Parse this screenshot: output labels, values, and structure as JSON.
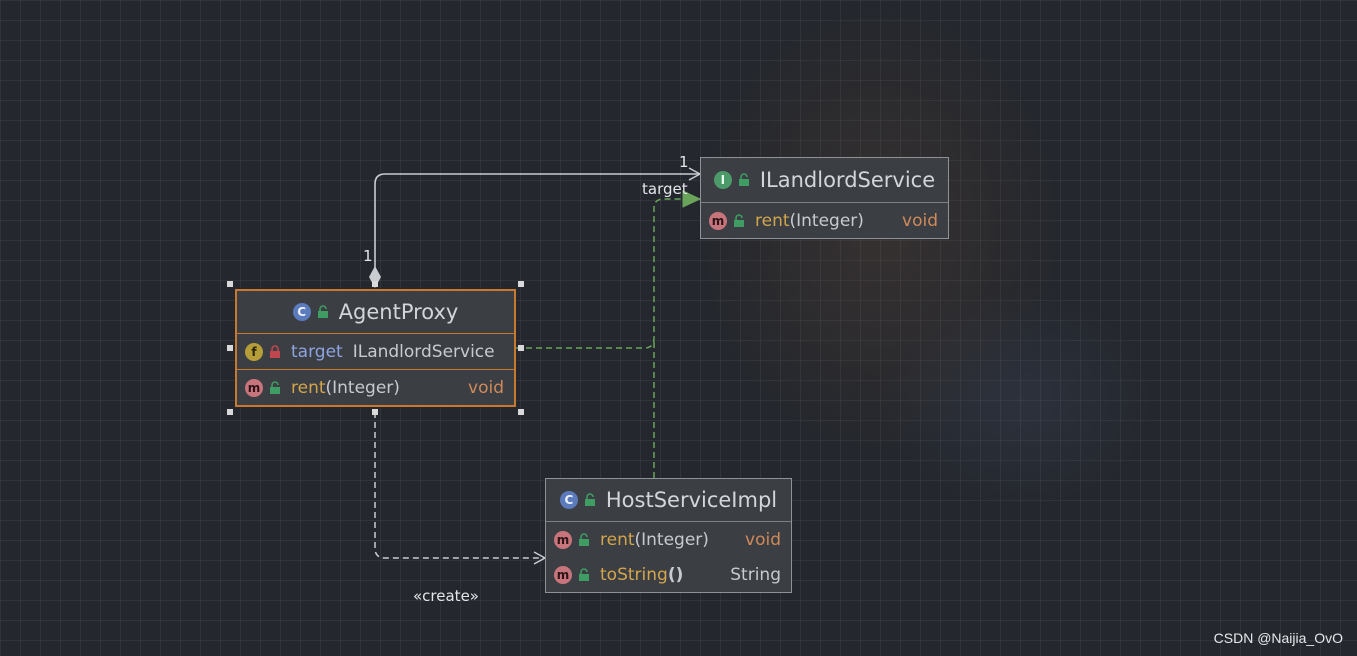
{
  "diagram": {
    "interface": {
      "name": "ILandlordService",
      "badge": "I",
      "methods": [
        {
          "badge": "m",
          "name": "rent",
          "params": "(Integer)",
          "returns": "void"
        }
      ]
    },
    "agent_proxy": {
      "name": "AgentProxy",
      "badge": "C",
      "fields": [
        {
          "badge": "f",
          "name": "target",
          "type": "ILandlordService"
        }
      ],
      "methods": [
        {
          "badge": "m",
          "name": "rent",
          "params": "(Integer)",
          "returns": "void"
        }
      ]
    },
    "host_service": {
      "name": "HostServiceImpl",
      "badge": "C",
      "methods": [
        {
          "badge": "m",
          "name": "rent",
          "params": "(Integer)",
          "returns": "void"
        },
        {
          "badge": "m",
          "name": "toString",
          "params": "()",
          "returns": "String"
        }
      ]
    },
    "edges": {
      "association_source_multiplicity": "1",
      "association_target_multiplicity": "1",
      "association_role": "target",
      "create_label": "«create»"
    }
  },
  "watermark": "CSDN @Naijia_OvO",
  "colors": {
    "background": "#24272d",
    "selection": "#c77a2f",
    "realization": "#6aa45a",
    "association": "#c9ccd1"
  }
}
